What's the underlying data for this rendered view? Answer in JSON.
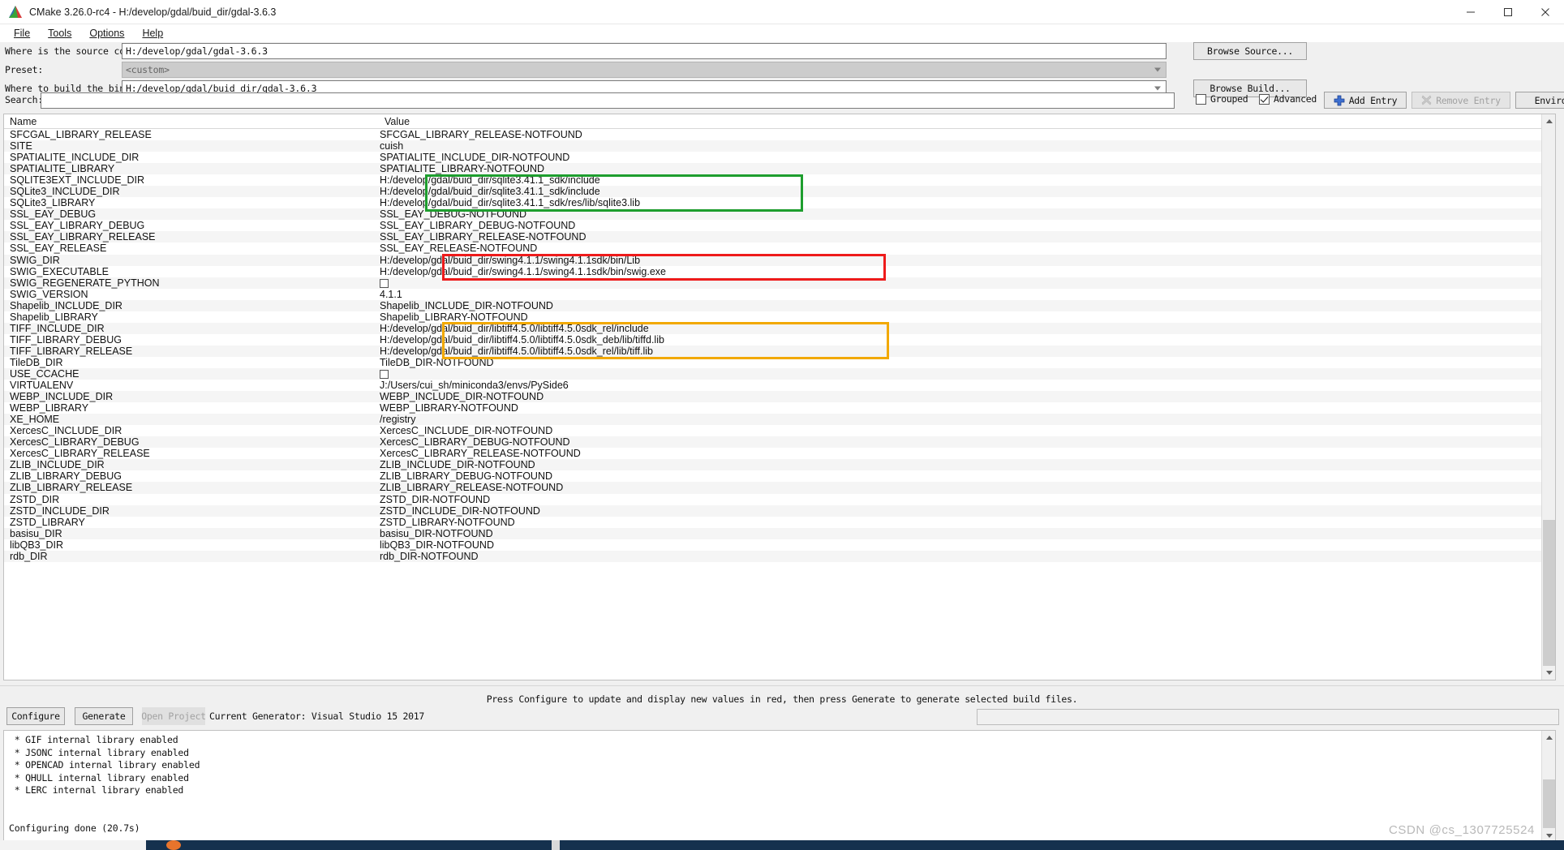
{
  "window": {
    "title": "CMake 3.26.0-rc4 - H:/develop/gdal/buid_dir/gdal-3.6.3",
    "app_icon": "cmake-triangle-icon",
    "minimize": "–",
    "maximize": "☐",
    "close": "✕"
  },
  "menu": [
    {
      "label": "File",
      "mnemonic": "F"
    },
    {
      "label": "Tools",
      "mnemonic": "T"
    },
    {
      "label": "Options",
      "mnemonic": "O"
    },
    {
      "label": "Help",
      "mnemonic": "H"
    }
  ],
  "form": {
    "source_label": "Where is the source code:",
    "source_value": "H:/develop/gdal/gdal-3.6.3",
    "browse_source": "Browse Source...",
    "preset_label": "Preset:",
    "preset_value": "<custom>",
    "build_label": "Where to build the binaries:",
    "build_value": "H:/develop/gdal/buid_dir/gdal-3.6.3",
    "browse_build": "Browse Build..."
  },
  "search": {
    "label": "Search:",
    "value": "",
    "placeholder": "",
    "grouped_label": "Grouped",
    "grouped_checked": false,
    "advanced_label": "Advanced",
    "advanced_checked": true,
    "add_entry": "Add Entry",
    "remove_entry": "Remove Entry",
    "environment": "Environment..."
  },
  "table": {
    "columns": [
      "Name",
      "Value"
    ],
    "rows": [
      {
        "name": "SFCGAL_LIBRARY_RELEASE",
        "value": "SFCGAL_LIBRARY_RELEASE-NOTFOUND",
        "type": "text"
      },
      {
        "name": "SITE",
        "value": "cuish",
        "type": "text"
      },
      {
        "name": "SPATIALITE_INCLUDE_DIR",
        "value": "SPATIALITE_INCLUDE_DIR-NOTFOUND",
        "type": "text"
      },
      {
        "name": "SPATIALITE_LIBRARY",
        "value": "SPATIALITE_LIBRARY-NOTFOUND",
        "type": "text"
      },
      {
        "name": "SQLITE3EXT_INCLUDE_DIR",
        "value": "H:/develop/gdal/buid_dir/sqlite3.41.1_sdk/include",
        "type": "text"
      },
      {
        "name": "SQLite3_INCLUDE_DIR",
        "value": "H:/develop/gdal/buid_dir/sqlite3.41.1_sdk/include",
        "type": "text"
      },
      {
        "name": "SQLite3_LIBRARY",
        "value": "H:/develop/gdal/buid_dir/sqlite3.41.1_sdk/res/lib/sqlite3.lib",
        "type": "text"
      },
      {
        "name": "SSL_EAY_DEBUG",
        "value": "SSL_EAY_DEBUG-NOTFOUND",
        "type": "text"
      },
      {
        "name": "SSL_EAY_LIBRARY_DEBUG",
        "value": "SSL_EAY_LIBRARY_DEBUG-NOTFOUND",
        "type": "text"
      },
      {
        "name": "SSL_EAY_LIBRARY_RELEASE",
        "value": "SSL_EAY_LIBRARY_RELEASE-NOTFOUND",
        "type": "text"
      },
      {
        "name": "SSL_EAY_RELEASE",
        "value": "SSL_EAY_RELEASE-NOTFOUND",
        "type": "text"
      },
      {
        "name": "SWIG_DIR",
        "value": "H:/develop/gdal/buid_dir/swing4.1.1/swing4.1.1sdk/bin/Lib",
        "type": "text"
      },
      {
        "name": "SWIG_EXECUTABLE",
        "value": "H:/develop/gdal/buid_dir/swing4.1.1/swing4.1.1sdk/bin/swig.exe",
        "type": "text"
      },
      {
        "name": "SWIG_REGENERATE_PYTHON",
        "value": "",
        "type": "checkbox",
        "checked": false
      },
      {
        "name": "SWIG_VERSION",
        "value": "4.1.1",
        "type": "text"
      },
      {
        "name": "Shapelib_INCLUDE_DIR",
        "value": "Shapelib_INCLUDE_DIR-NOTFOUND",
        "type": "text"
      },
      {
        "name": "Shapelib_LIBRARY",
        "value": "Shapelib_LIBRARY-NOTFOUND",
        "type": "text"
      },
      {
        "name": "TIFF_INCLUDE_DIR",
        "value": "H:/develop/gdal/buid_dir/libtiff4.5.0/libtiff4.5.0sdk_rel/include",
        "type": "text"
      },
      {
        "name": "TIFF_LIBRARY_DEBUG",
        "value": "H:/develop/gdal/buid_dir/libtiff4.5.0/libtiff4.5.0sdk_deb/lib/tiffd.lib",
        "type": "text"
      },
      {
        "name": "TIFF_LIBRARY_RELEASE",
        "value": "H:/develop/gdal/buid_dir/libtiff4.5.0/libtiff4.5.0sdk_rel/lib/tiff.lib",
        "type": "text"
      },
      {
        "name": "TileDB_DIR",
        "value": "TileDB_DIR-NOTFOUND",
        "type": "text"
      },
      {
        "name": "USE_CCACHE",
        "value": "",
        "type": "checkbox",
        "checked": false
      },
      {
        "name": "VIRTUALENV",
        "value": "J:/Users/cui_sh/miniconda3/envs/PySide6",
        "type": "text"
      },
      {
        "name": "WEBP_INCLUDE_DIR",
        "value": "WEBP_INCLUDE_DIR-NOTFOUND",
        "type": "text"
      },
      {
        "name": "WEBP_LIBRARY",
        "value": "WEBP_LIBRARY-NOTFOUND",
        "type": "text"
      },
      {
        "name": "XE_HOME",
        "value": "/registry",
        "type": "text"
      },
      {
        "name": "XercesC_INCLUDE_DIR",
        "value": "XercesC_INCLUDE_DIR-NOTFOUND",
        "type": "text"
      },
      {
        "name": "XercesC_LIBRARY_DEBUG",
        "value": "XercesC_LIBRARY_DEBUG-NOTFOUND",
        "type": "text"
      },
      {
        "name": "XercesC_LIBRARY_RELEASE",
        "value": "XercesC_LIBRARY_RELEASE-NOTFOUND",
        "type": "text"
      },
      {
        "name": "ZLIB_INCLUDE_DIR",
        "value": "ZLIB_INCLUDE_DIR-NOTFOUND",
        "type": "text"
      },
      {
        "name": "ZLIB_LIBRARY_DEBUG",
        "value": "ZLIB_LIBRARY_DEBUG-NOTFOUND",
        "type": "text"
      },
      {
        "name": "ZLIB_LIBRARY_RELEASE",
        "value": "ZLIB_LIBRARY_RELEASE-NOTFOUND",
        "type": "text"
      },
      {
        "name": "ZSTD_DIR",
        "value": "ZSTD_DIR-NOTFOUND",
        "type": "text"
      },
      {
        "name": "ZSTD_INCLUDE_DIR",
        "value": "ZSTD_INCLUDE_DIR-NOTFOUND",
        "type": "text"
      },
      {
        "name": "ZSTD_LIBRARY",
        "value": "ZSTD_LIBRARY-NOTFOUND",
        "type": "text"
      },
      {
        "name": "basisu_DIR",
        "value": "basisu_DIR-NOTFOUND",
        "type": "text"
      },
      {
        "name": "libQB3_DIR",
        "value": "libQB3_DIR-NOTFOUND",
        "type": "text"
      },
      {
        "name": "rdb_DIR",
        "value": "rdb_DIR-NOTFOUND",
        "type": "text"
      }
    ]
  },
  "annotations": [
    {
      "color": "#1e9e2e",
      "name": "sqlite-highlight-box"
    },
    {
      "color": "#ee1b1b",
      "name": "swig-highlight-box"
    },
    {
      "color": "#f2a900",
      "name": "tiff-highlight-box"
    }
  ],
  "status": {
    "message": "Press Configure to update and display new values in red, then press Generate to generate selected build files.",
    "configure": "Configure",
    "generate": "Generate",
    "open_project": "Open Project",
    "current_generator": "Current Generator: Visual Studio 15 2017"
  },
  "log": {
    "lines": [
      " * GIF internal library enabled",
      " * JSONC internal library enabled",
      " * OPENCAD internal library enabled",
      " * QHULL internal library enabled",
      " * LERC internal library enabled",
      "",
      "",
      "Configuring done (20.7s)"
    ]
  },
  "watermark": "CSDN @cs_1307725524"
}
